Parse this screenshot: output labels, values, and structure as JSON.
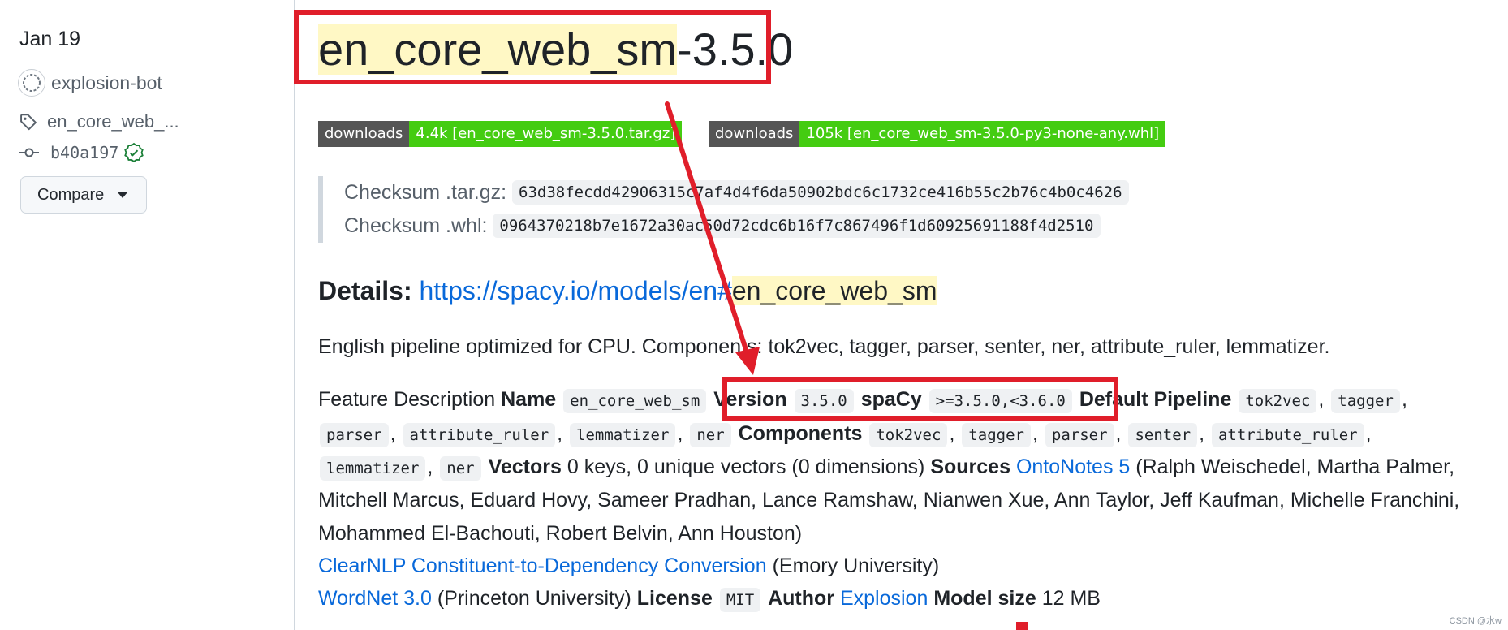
{
  "sidebar": {
    "date": "Jan 19",
    "author": "explosion-bot",
    "tag": "en_core_web_...",
    "commit": "b40a197",
    "compare_label": "Compare"
  },
  "release": {
    "title_highlight": "en_core_web_sm",
    "title_rest": "-3.5.0",
    "badges": [
      {
        "label": "downloads",
        "value": "4.4k [en_core_web_sm-3.5.0.tar.gz]"
      },
      {
        "label": "downloads",
        "value": "105k [en_core_web_sm-3.5.0-py3-none-any.whl]"
      }
    ],
    "checksums": [
      {
        "label": "Checksum .tar.gz:",
        "value": "63d38fecdd42906315c7af4d4f6da50902bdc6c1732ce416b55c2b76c4b0c4626"
      },
      {
        "label": "Checksum .whl:",
        "value": "0964370218b7e1672a30ac50d72cdc6b16f7c867496f1d60925691188f4d2510"
      }
    ],
    "details_label": "Details:",
    "details_link_prefix": "https://spacy.io/models/en",
    "details_link_hash": "#",
    "details_link_highlight": "en_core_web_sm",
    "description": "English pipeline optimized for CPU. Components: tok2vec, tagger, parser, senter, ner, attribute_ruler, lemmatizer.",
    "feature": {
      "intro": "Feature Description",
      "name_label": "Name",
      "name_value": "en_core_web_sm",
      "version_label": "Version",
      "version_value": "3.5.0",
      "spacy_label": "spaCy",
      "spacy_value": ">=3.5.0,<3.6.0",
      "pipeline_label": "Default Pipeline",
      "pipeline": [
        "tok2vec",
        "tagger",
        "parser",
        "attribute_ruler",
        "lemmatizer",
        "ner"
      ],
      "components_label": "Components",
      "components": [
        "tok2vec",
        "tagger",
        "parser",
        "senter",
        "attribute_ruler",
        "lemmatizer",
        "ner"
      ],
      "vectors_label": "Vectors",
      "vectors_value": "0 keys, 0 unique vectors (0 dimensions)",
      "sources_label": "Sources",
      "ontonotes_link": "OntoNotes 5",
      "ontonotes_authors_1": "(Ralph Weischedel, Martha Palmer,",
      "ontonotes_authors_2": "Mitchell Marcus, Eduard Hovy, Sameer Pradhan, Lance Ramshaw, Nianwen Xue, Ann Taylor, Jeff Kaufman, Michelle Franchini,",
      "ontonotes_authors_3": "Mohammed El-Bachouti, Robert Belvin, Ann Houston)",
      "clearnlp_link": "ClearNLP Constituent-to-Dependency Conversion",
      "clearnlp_org": "(Emory University)",
      "wordnet_link": "WordNet 3.0",
      "wordnet_org": "(Princeton University)",
      "license_label": "License",
      "license_value": "MIT",
      "author_label": "Author",
      "author_link": "Explosion",
      "size_label": "Model size",
      "size_value": "12 MB"
    }
  },
  "watermark": "CSDN @水w",
  "colors": {
    "annotation_red": "#e01e2a",
    "link": "#0969da",
    "highlight": "#fff8c5",
    "badge_green": "#44cc11"
  }
}
